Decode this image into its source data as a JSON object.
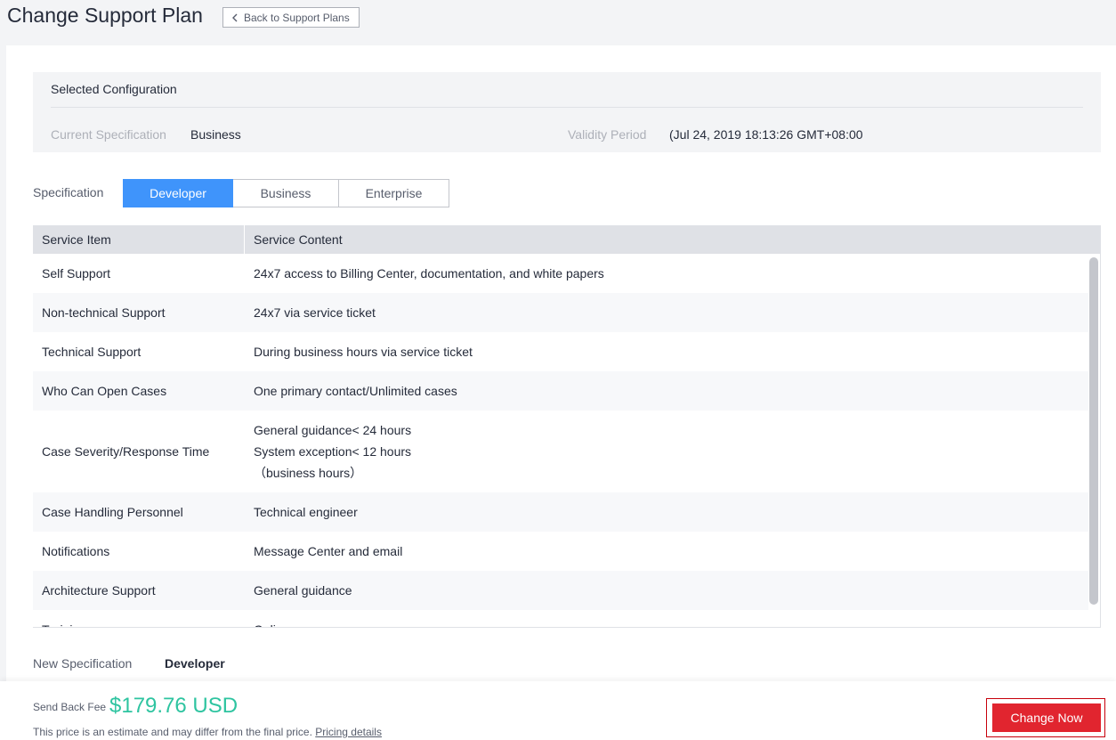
{
  "header": {
    "title": "Change Support Plan",
    "back_label": "Back to Support Plans"
  },
  "selected_configuration": {
    "title": "Selected Configuration",
    "current_spec_label": "Current Specification",
    "current_spec_value": "Business",
    "validity_label": "Validity Period",
    "validity_value": "(Jul 24, 2019 18:13:26 GMT+08:00"
  },
  "specification": {
    "label": "Specification",
    "tabs": [
      {
        "label": "Developer",
        "active": true
      },
      {
        "label": "Business",
        "active": false
      },
      {
        "label": "Enterprise",
        "active": false
      }
    ]
  },
  "table": {
    "headers": [
      "Service Item",
      "Service Content"
    ],
    "rows": [
      {
        "item": "Self Support",
        "content": [
          "24x7 access to Billing Center, documentation, and white papers"
        ]
      },
      {
        "item": "Non-technical Support",
        "content": [
          "24x7 via service ticket"
        ]
      },
      {
        "item": "Technical Support",
        "content": [
          "During business hours via service ticket"
        ]
      },
      {
        "item": "Who Can Open Cases",
        "content": [
          "One primary contact/Unlimited cases"
        ]
      },
      {
        "item": "Case Severity/Response Time",
        "content": [
          "General guidance< 24 hours",
          "System exception< 12 hours",
          "（business hours）"
        ]
      },
      {
        "item": "Case Handling Personnel",
        "content": [
          "Technical engineer"
        ]
      },
      {
        "item": "Notifications",
        "content": [
          "Message Center and email"
        ]
      },
      {
        "item": "Architecture Support",
        "content": [
          "General guidance"
        ]
      },
      {
        "item": "Training",
        "content": [
          "Online"
        ]
      }
    ]
  },
  "new_specification": {
    "label": "New Specification",
    "value": "Developer"
  },
  "footer": {
    "fee_label": "Send Back Fee",
    "fee_value": "$179.76 USD",
    "note": "This price is an estimate and may differ from the final price.",
    "pricing_link": "Pricing details",
    "change_button": "Change Now"
  }
}
